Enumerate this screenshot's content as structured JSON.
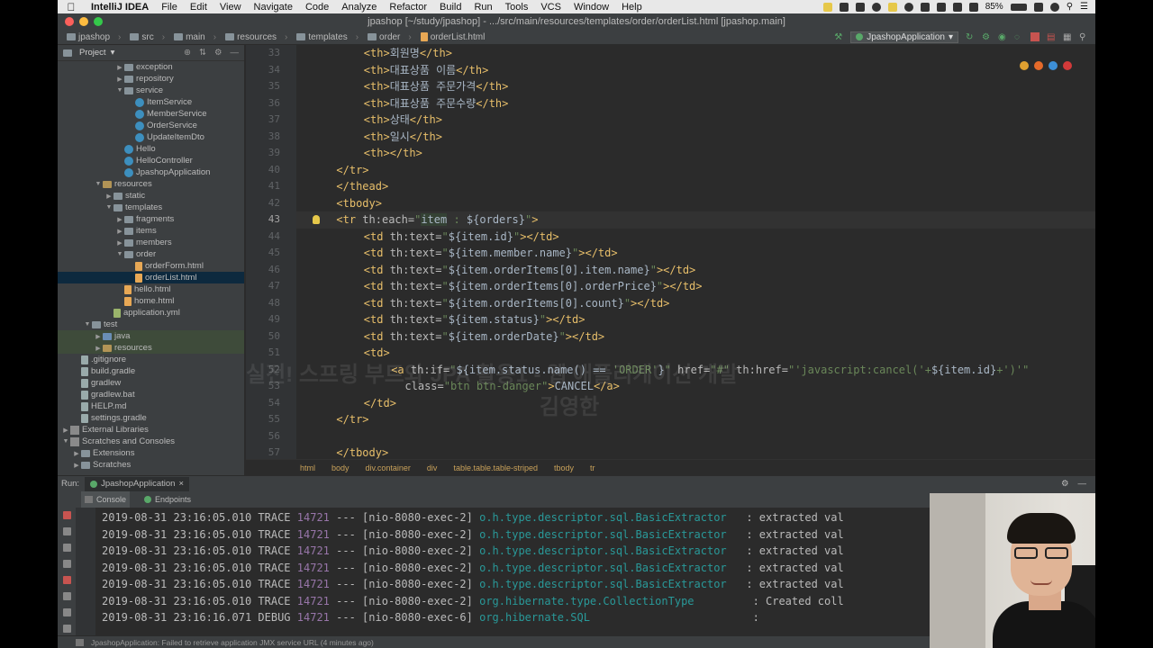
{
  "menubar": {
    "app_name": "IntelliJ IDEA",
    "items": [
      "File",
      "Edit",
      "View",
      "Navigate",
      "Code",
      "Analyze",
      "Refactor",
      "Build",
      "Run",
      "Tools",
      "VCS",
      "Window",
      "Help"
    ],
    "battery": "85%",
    "accent": "#e8e8e8"
  },
  "window": {
    "title": "jpashop [~/study/jpashop] - .../src/main/resources/templates/order/orderList.html [jpashop.main]"
  },
  "navbar": {
    "crumbs": [
      "jpashop",
      "src",
      "main",
      "resources",
      "templates",
      "order",
      "orderList.html"
    ],
    "run_config": "JpashopApplication"
  },
  "project": {
    "title": "Project",
    "tree": [
      {
        "label": "exception",
        "depth": 5,
        "icon": "fold",
        "arrow": "right"
      },
      {
        "label": "repository",
        "depth": 5,
        "icon": "fold",
        "arrow": "right"
      },
      {
        "label": "service",
        "depth": 5,
        "icon": "fold",
        "arrow": "down"
      },
      {
        "label": "ItemService",
        "depth": 6,
        "icon": "cls",
        "arrow": ""
      },
      {
        "label": "MemberService",
        "depth": 6,
        "icon": "cls",
        "arrow": ""
      },
      {
        "label": "OrderService",
        "depth": 6,
        "icon": "cls",
        "arrow": ""
      },
      {
        "label": "UpdateItemDto",
        "depth": 6,
        "icon": "cls",
        "arrow": ""
      },
      {
        "label": "Hello",
        "depth": 5,
        "icon": "cls",
        "arrow": ""
      },
      {
        "label": "HelloController",
        "depth": 5,
        "icon": "cls",
        "arrow": ""
      },
      {
        "label": "JpashopApplication",
        "depth": 5,
        "icon": "cls",
        "arrow": ""
      },
      {
        "label": "resources",
        "depth": 3,
        "icon": "fold res",
        "arrow": "down"
      },
      {
        "label": "static",
        "depth": 4,
        "icon": "fold",
        "arrow": "right"
      },
      {
        "label": "templates",
        "depth": 4,
        "icon": "fold",
        "arrow": "down"
      },
      {
        "label": "fragments",
        "depth": 5,
        "icon": "fold",
        "arrow": "right"
      },
      {
        "label": "items",
        "depth": 5,
        "icon": "fold",
        "arrow": "right"
      },
      {
        "label": "members",
        "depth": 5,
        "icon": "fold",
        "arrow": "right"
      },
      {
        "label": "order",
        "depth": 5,
        "icon": "fold",
        "arrow": "down"
      },
      {
        "label": "orderForm.html",
        "depth": 6,
        "icon": "html",
        "arrow": ""
      },
      {
        "label": "orderList.html",
        "depth": 6,
        "icon": "html",
        "arrow": "",
        "selected": true
      },
      {
        "label": "hello.html",
        "depth": 5,
        "icon": "html",
        "arrow": ""
      },
      {
        "label": "home.html",
        "depth": 5,
        "icon": "html",
        "arrow": ""
      },
      {
        "label": "application.yml",
        "depth": 4,
        "icon": "yml",
        "arrow": ""
      },
      {
        "label": "test",
        "depth": 2,
        "icon": "fold",
        "arrow": "down"
      },
      {
        "label": "java",
        "depth": 3,
        "icon": "fold src",
        "arrow": "right",
        "highlight": true
      },
      {
        "label": "resources",
        "depth": 3,
        "icon": "fold res",
        "arrow": "right",
        "highlight": true
      },
      {
        "label": ".gitignore",
        "depth": 1,
        "icon": "txt",
        "arrow": ""
      },
      {
        "label": "build.gradle",
        "depth": 1,
        "icon": "txt",
        "arrow": ""
      },
      {
        "label": "gradlew",
        "depth": 1,
        "icon": "txt",
        "arrow": ""
      },
      {
        "label": "gradlew.bat",
        "depth": 1,
        "icon": "txt",
        "arrow": ""
      },
      {
        "label": "HELP.md",
        "depth": 1,
        "icon": "txt",
        "arrow": ""
      },
      {
        "label": "settings.gradle",
        "depth": 1,
        "icon": "txt",
        "arrow": ""
      },
      {
        "label": "External Libraries",
        "depth": 0,
        "icon": "lib",
        "arrow": "right"
      },
      {
        "label": "Scratches and Consoles",
        "depth": 0,
        "icon": "lib",
        "arrow": "down"
      },
      {
        "label": "Extensions",
        "depth": 1,
        "icon": "fold",
        "arrow": "right"
      },
      {
        "label": "Scratches",
        "depth": 1,
        "icon": "fold",
        "arrow": "right"
      }
    ]
  },
  "editor": {
    "current_line": "43",
    "lines": [
      {
        "n": "33",
        "indent": 8,
        "parts": [
          [
            "tag",
            "<th>"
          ],
          [
            "ex",
            "회원명"
          ],
          [
            "tag",
            "</th>"
          ]
        ]
      },
      {
        "n": "34",
        "indent": 8,
        "parts": [
          [
            "tag",
            "<th>"
          ],
          [
            "ex",
            "대표상품 이름"
          ],
          [
            "tag",
            "</th>"
          ]
        ]
      },
      {
        "n": "35",
        "indent": 8,
        "parts": [
          [
            "tag",
            "<th>"
          ],
          [
            "ex",
            "대표상품 주문가격"
          ],
          [
            "tag",
            "</th>"
          ]
        ]
      },
      {
        "n": "36",
        "indent": 8,
        "parts": [
          [
            "tag",
            "<th>"
          ],
          [
            "ex",
            "대표상품 주문수량"
          ],
          [
            "tag",
            "</th>"
          ]
        ]
      },
      {
        "n": "37",
        "indent": 8,
        "parts": [
          [
            "tag",
            "<th>"
          ],
          [
            "ex",
            "상태"
          ],
          [
            "tag",
            "</th>"
          ]
        ]
      },
      {
        "n": "38",
        "indent": 8,
        "parts": [
          [
            "tag",
            "<th>"
          ],
          [
            "ex",
            "일시"
          ],
          [
            "tag",
            "</th>"
          ]
        ]
      },
      {
        "n": "39",
        "indent": 8,
        "parts": [
          [
            "tag",
            "<th></th>"
          ]
        ]
      },
      {
        "n": "40",
        "indent": 4,
        "parts": [
          [
            "tag",
            "</tr>"
          ]
        ]
      },
      {
        "n": "41",
        "indent": 4,
        "parts": [
          [
            "tag",
            "</thead>"
          ]
        ]
      },
      {
        "n": "42",
        "indent": 4,
        "parts": [
          [
            "tag",
            "<tbody>"
          ]
        ]
      },
      {
        "n": "43",
        "indent": 4,
        "parts": [
          [
            "tag",
            "<tr "
          ],
          [
            "attr",
            "th:each="
          ],
          [
            "str",
            "\""
          ],
          [
            "hl",
            "item"
          ],
          [
            "str",
            " : "
          ],
          [
            "ex",
            "${orders}"
          ],
          [
            "str",
            "\""
          ],
          [
            "tag",
            ">"
          ]
        ]
      },
      {
        "n": "44",
        "indent": 8,
        "parts": [
          [
            "tag",
            "<td "
          ],
          [
            "attr",
            "th:text="
          ],
          [
            "str",
            "\""
          ],
          [
            "ex",
            "${item.id}"
          ],
          [
            "str",
            "\""
          ],
          [
            "tag",
            "></td>"
          ]
        ]
      },
      {
        "n": "45",
        "indent": 8,
        "parts": [
          [
            "tag",
            "<td "
          ],
          [
            "attr",
            "th:text="
          ],
          [
            "str",
            "\""
          ],
          [
            "ex",
            "${item.member.name}"
          ],
          [
            "str",
            "\""
          ],
          [
            "tag",
            "></td>"
          ]
        ]
      },
      {
        "n": "46",
        "indent": 8,
        "parts": [
          [
            "tag",
            "<td "
          ],
          [
            "attr",
            "th:text="
          ],
          [
            "str",
            "\""
          ],
          [
            "ex",
            "${item.orderItems[0].item.name}"
          ],
          [
            "str",
            "\""
          ],
          [
            "tag",
            "></td>"
          ]
        ]
      },
      {
        "n": "47",
        "indent": 8,
        "parts": [
          [
            "tag",
            "<td "
          ],
          [
            "attr",
            "th:text="
          ],
          [
            "str",
            "\""
          ],
          [
            "ex",
            "${item.orderItems[0].orderPrice}"
          ],
          [
            "str",
            "\""
          ],
          [
            "tag",
            "></td>"
          ]
        ]
      },
      {
        "n": "48",
        "indent": 8,
        "parts": [
          [
            "tag",
            "<td "
          ],
          [
            "attr",
            "th:text="
          ],
          [
            "str",
            "\""
          ],
          [
            "ex",
            "${item.orderItems[0].count}"
          ],
          [
            "str",
            "\""
          ],
          [
            "tag",
            "></td>"
          ]
        ]
      },
      {
        "n": "49",
        "indent": 8,
        "parts": [
          [
            "tag",
            "<td "
          ],
          [
            "attr",
            "th:text="
          ],
          [
            "str",
            "\""
          ],
          [
            "ex",
            "${item.status}"
          ],
          [
            "str",
            "\""
          ],
          [
            "tag",
            "></td>"
          ]
        ]
      },
      {
        "n": "50",
        "indent": 8,
        "parts": [
          [
            "tag",
            "<td "
          ],
          [
            "attr",
            "th:text="
          ],
          [
            "str",
            "\""
          ],
          [
            "ex",
            "${item.orderDate}"
          ],
          [
            "str",
            "\""
          ],
          [
            "tag",
            "></td>"
          ]
        ]
      },
      {
        "n": "51",
        "indent": 8,
        "parts": [
          [
            "tag",
            "<td>"
          ]
        ]
      },
      {
        "n": "52",
        "indent": 12,
        "parts": [
          [
            "tag",
            "<a "
          ],
          [
            "attr",
            "th:if="
          ],
          [
            "str",
            "\""
          ],
          [
            "ex",
            "${item.status.name() == "
          ],
          [
            "str",
            "'ORDER'"
          ],
          [
            "ex",
            "}"
          ],
          [
            "str",
            "\""
          ],
          [
            "attr",
            " href="
          ],
          [
            "str",
            "\"#\""
          ],
          [
            "attr",
            " th:href="
          ],
          [
            "str",
            "\"'javascript:cancel('+"
          ],
          [
            "ex",
            "${item.id}"
          ],
          [
            "str",
            "+')'\""
          ]
        ]
      },
      {
        "n": "53",
        "indent": 14,
        "parts": [
          [
            "attr",
            "class="
          ],
          [
            "str",
            "\"btn btn-danger\""
          ],
          [
            "tag",
            ">"
          ],
          [
            "ex",
            "CANCEL"
          ],
          [
            "tag",
            "</a>"
          ]
        ]
      },
      {
        "n": "54",
        "indent": 8,
        "parts": [
          [
            "tag",
            "</td>"
          ]
        ]
      },
      {
        "n": "55",
        "indent": 4,
        "parts": [
          [
            "tag",
            "</tr>"
          ]
        ]
      },
      {
        "n": "56",
        "indent": 0,
        "parts": []
      },
      {
        "n": "57",
        "indent": 4,
        "parts": [
          [
            "tag",
            "</tbody>"
          ]
        ]
      }
    ],
    "breadcrumbs": [
      "html",
      "body",
      "div.container",
      "div",
      "table.table.table-striped",
      "tbody",
      "tr"
    ]
  },
  "watermark": {
    "line1": "실전! 스프링 부트와 JPA 활용1 - 웹 애플리케이션 개발",
    "line2": "김영한"
  },
  "run": {
    "label": "Run:",
    "tab": "JpashopApplication",
    "subtabs": [
      "Console",
      "Endpoints"
    ]
  },
  "console": {
    "lines": [
      {
        "ts": "2019-08-31 23:16:05.010",
        "lvl": "TRACE",
        "pid": "14721",
        "sep": "---",
        "thread": "[nio-8080-exec-2]",
        "logger": "o.h.type.descriptor.sql.BasicExtractor  ",
        "msg": ": extracted val"
      },
      {
        "ts": "2019-08-31 23:16:05.010",
        "lvl": "TRACE",
        "pid": "14721",
        "sep": "---",
        "thread": "[nio-8080-exec-2]",
        "logger": "o.h.type.descriptor.sql.BasicExtractor  ",
        "msg": ": extracted val"
      },
      {
        "ts": "2019-08-31 23:16:05.010",
        "lvl": "TRACE",
        "pid": "14721",
        "sep": "---",
        "thread": "[nio-8080-exec-2]",
        "logger": "o.h.type.descriptor.sql.BasicExtractor  ",
        "msg": ": extracted val"
      },
      {
        "ts": "2019-08-31 23:16:05.010",
        "lvl": "TRACE",
        "pid": "14721",
        "sep": "---",
        "thread": "[nio-8080-exec-2]",
        "logger": "o.h.type.descriptor.sql.BasicExtractor  ",
        "msg": ": extracted val"
      },
      {
        "ts": "2019-08-31 23:16:05.010",
        "lvl": "TRACE",
        "pid": "14721",
        "sep": "---",
        "thread": "[nio-8080-exec-2]",
        "logger": "o.h.type.descriptor.sql.BasicExtractor  ",
        "msg": ": extracted val"
      },
      {
        "ts": "2019-08-31 23:16:05.010",
        "lvl": "TRACE",
        "pid": "14721",
        "sep": "---",
        "thread": "[nio-8080-exec-2]",
        "logger": "org.hibernate.type.CollectionType        ",
        "msg": ": Created coll"
      },
      {
        "ts": "2019-08-31 23:16:16.071",
        "lvl": "DEBUG",
        "pid": "14721",
        "sep": "---",
        "thread": "[nio-8080-exec-6]",
        "logger": "org.hibernate.SQL                        ",
        "msg": ":"
      }
    ]
  },
  "statusbar": {
    "message": "JpashopApplication: Failed to retrieve application JMX service URL (4 minutes ago)"
  }
}
